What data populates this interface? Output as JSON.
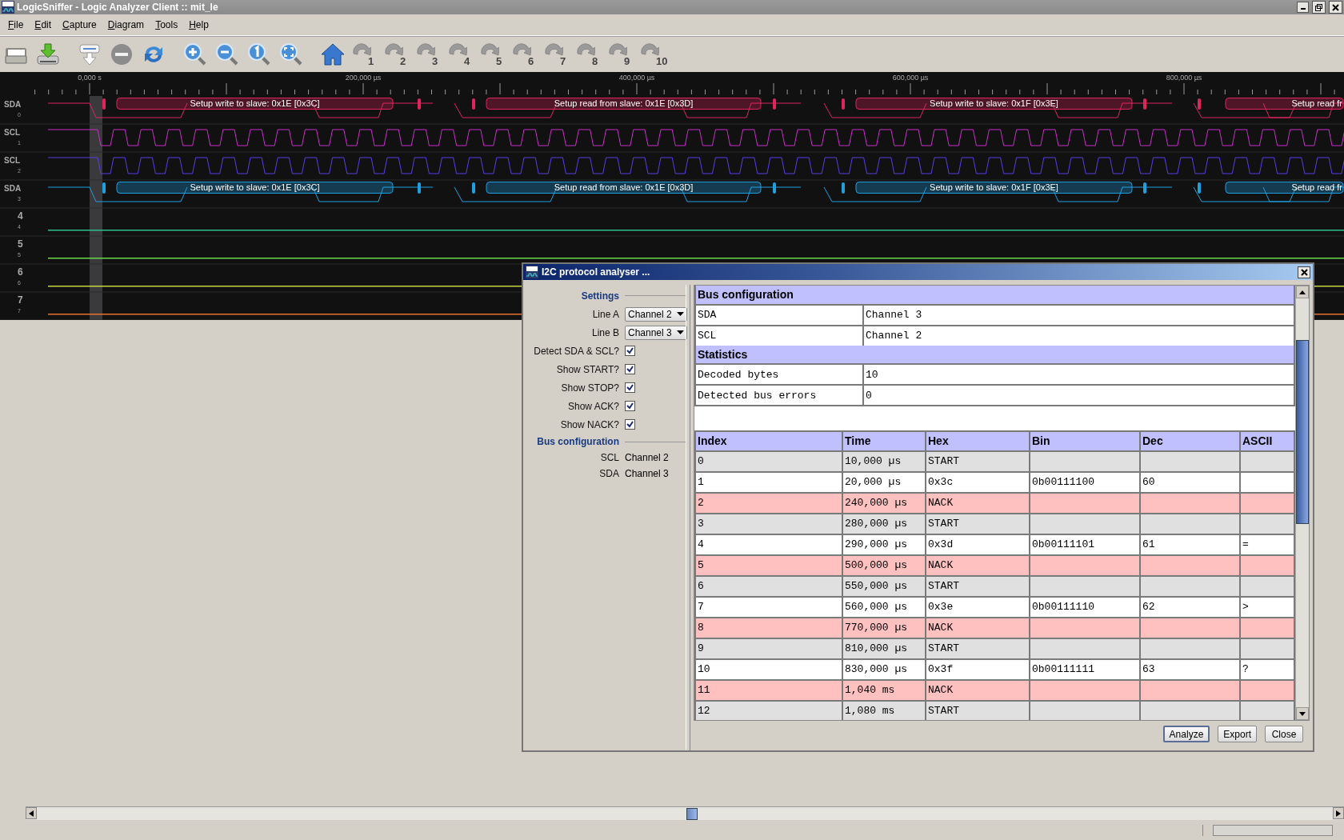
{
  "window": {
    "title": "LogicSniffer - Logic Analyzer Client :: mit_le"
  },
  "menu": [
    "File",
    "Edit",
    "Capture",
    "Diagram",
    "Tools",
    "Help"
  ],
  "toolbar": {
    "cursors": [
      "1",
      "2",
      "3",
      "4",
      "5",
      "6",
      "7",
      "8",
      "9",
      "10"
    ]
  },
  "waveform": {
    "ruler": [
      "0,000 s",
      "200,000 µs",
      "400,000 µs",
      "600,000 µs",
      "800,000 µs"
    ],
    "channels": [
      {
        "kind": "data",
        "name": "SDA",
        "index": "0",
        "color": "#e0245e",
        "annotations": [
          "Setup write to slave: 0x1E [0x3C]",
          "Setup read from slave: 0x1E [0x3D]",
          "Setup write to slave: 0x1F [0x3E]",
          "Setup read fr"
        ]
      },
      {
        "kind": "clock",
        "name": "SCL",
        "index": "1",
        "color": "#c82ec8"
      },
      {
        "kind": "clock",
        "name": "SCL",
        "index": "2",
        "color": "#5b3de6"
      },
      {
        "kind": "data",
        "name": "SDA",
        "index": "3",
        "color": "#1e9fe0",
        "annotations": [
          "Setup write to slave: 0x1E [0x3C]",
          "Setup read from slave: 0x1E [0x3D]",
          "Setup write to slave: 0x1F [0x3E]",
          "Setup read fr"
        ]
      },
      {
        "kind": "idle",
        "name": "4",
        "index": "4",
        "color": "#2fbf8f"
      },
      {
        "kind": "idle",
        "name": "5",
        "index": "5",
        "color": "#6fd64a"
      },
      {
        "kind": "idle",
        "name": "6",
        "index": "6",
        "color": "#c8d440"
      },
      {
        "kind": "idle",
        "name": "7",
        "index": "7",
        "color": "#e8722e"
      }
    ]
  },
  "analyser": {
    "title": "I2C protocol analyser ...",
    "settings": {
      "heading": "Settings",
      "lines": [
        {
          "label": "Line A",
          "value": "Channel 2"
        },
        {
          "label": "Line B",
          "value": "Channel 3"
        }
      ],
      "options": [
        {
          "label": "Detect SDA & SCL?",
          "checked": true
        },
        {
          "label": "Show START?",
          "checked": true
        },
        {
          "label": "Show STOP?",
          "checked": true
        },
        {
          "label": "Show ACK?",
          "checked": true
        },
        {
          "label": "Show NACK?",
          "checked": true
        }
      ]
    },
    "bus_configuration": {
      "heading": "Bus configuration",
      "items": [
        {
          "label": "SCL",
          "value": "Channel 2"
        },
        {
          "label": "SDA",
          "value": "Channel 3"
        }
      ]
    },
    "report": {
      "bus_heading": "Bus configuration",
      "bus_rows": [
        {
          "label": "SDA",
          "value": "Channel 3"
        },
        {
          "label": "SCL",
          "value": "Channel 2"
        }
      ],
      "stats_heading": "Statistics",
      "stats_rows": [
        {
          "label": "Decoded bytes",
          "value": "10"
        },
        {
          "label": "Detected bus errors",
          "value": "0"
        }
      ],
      "columns": [
        "Index",
        "Time",
        "Hex",
        "Bin",
        "Dec",
        "ASCII"
      ],
      "rows": [
        {
          "kind": "start",
          "cells": [
            "0",
            "10,000 µs",
            "START"
          ]
        },
        {
          "kind": "data",
          "cells": [
            "1",
            "20,000 µs",
            "0x3c",
            "0b00111100",
            "60"
          ]
        },
        {
          "kind": "nack",
          "cells": [
            "2",
            "240,000 µs",
            "NACK"
          ]
        },
        {
          "kind": "start",
          "cells": [
            "3",
            "280,000 µs",
            "START"
          ]
        },
        {
          "kind": "data",
          "cells": [
            "4",
            "290,000 µs",
            "0x3d",
            "0b00111101",
            "61",
            "="
          ]
        },
        {
          "kind": "nack",
          "cells": [
            "5",
            "500,000 µs",
            "NACK"
          ]
        },
        {
          "kind": "start",
          "cells": [
            "6",
            "550,000 µs",
            "START"
          ]
        },
        {
          "kind": "data",
          "cells": [
            "7",
            "560,000 µs",
            "0x3e",
            "0b00111110",
            "62",
            ">"
          ]
        },
        {
          "kind": "nack",
          "cells": [
            "8",
            "770,000 µs",
            "NACK"
          ]
        },
        {
          "kind": "start",
          "cells": [
            "9",
            "810,000 µs",
            "START"
          ]
        },
        {
          "kind": "data",
          "cells": [
            "10",
            "830,000 µs",
            "0x3f",
            "0b00111111",
            "63",
            "?"
          ]
        },
        {
          "kind": "nack",
          "cells": [
            "11",
            "1,040 ms",
            "NACK"
          ]
        },
        {
          "kind": "start",
          "cells": [
            "12",
            "1,080 ms",
            "START"
          ]
        }
      ]
    },
    "buttons": [
      {
        "label": "Analyze",
        "default": true
      },
      {
        "label": "Export",
        "default": false
      },
      {
        "label": "Close",
        "default": false
      }
    ]
  },
  "status_bar": {
    "progress": {
      "level": 0
    }
  }
}
